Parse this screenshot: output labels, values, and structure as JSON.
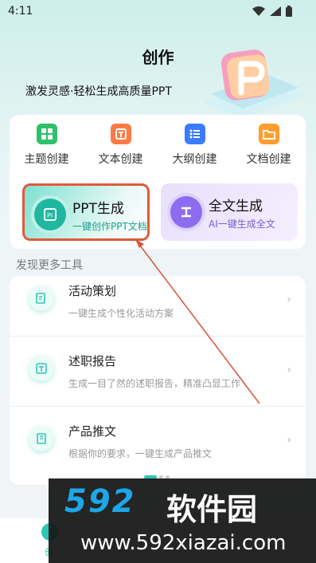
{
  "status": {
    "time": "4:11"
  },
  "header": {
    "title": "创作",
    "slogan": "激发灵感·轻松生成高质量PPT"
  },
  "categories": [
    {
      "label": "主题创建",
      "icon": "grid-icon",
      "color": "#2ec06a"
    },
    {
      "label": "文本创建",
      "icon": "text-icon",
      "color": "#ff7a45"
    },
    {
      "label": "大纲创建",
      "icon": "list-icon",
      "color": "#3a7bff"
    },
    {
      "label": "文档创建",
      "icon": "folder-icon",
      "color": "#ff9d2e"
    }
  ],
  "big_cards": [
    {
      "title": "PPT生成",
      "subtitle": "一键创作PPT文档",
      "icon": "ppt-icon"
    },
    {
      "title": "全文生成",
      "subtitle": "AI一键生成全文",
      "icon": "document-icon"
    }
  ],
  "section_title": "发现更多工具",
  "tools": [
    {
      "name": "活动策划",
      "desc": "一键生成个性化活动方案",
      "icon": "edit-icon"
    },
    {
      "name": "述职报告",
      "desc": "生成一目了然的述职报告，精准凸显工作",
      "icon": "text-doc-icon"
    },
    {
      "name": "产品推文",
      "desc": "根据你的要求，一键生成产品推文",
      "icon": "note-icon"
    }
  ],
  "tabbar": {
    "label": "创"
  },
  "watermark": {
    "brand_num": "592",
    "brand_text": "软件园",
    "url": "www.592xiazai.com"
  },
  "colors": {
    "accent": "#2ec7b5",
    "highlight_border": "#e05a3a"
  }
}
